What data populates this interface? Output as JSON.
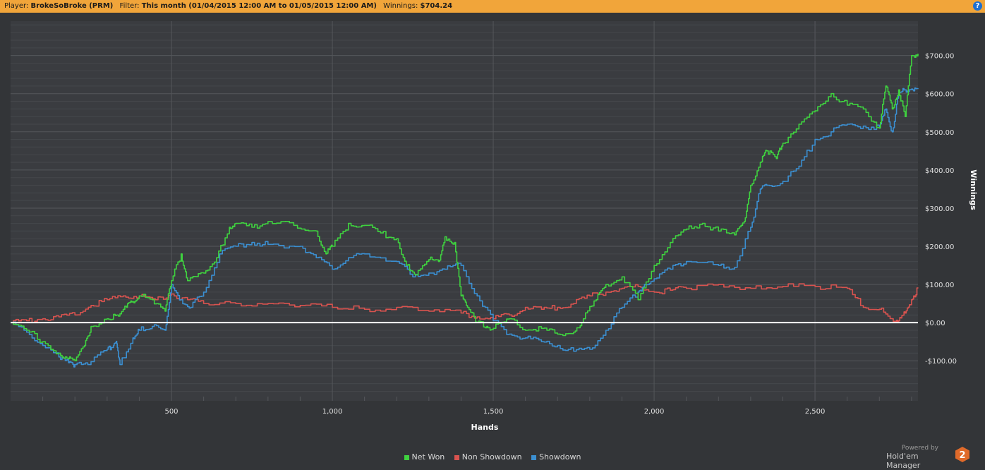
{
  "header": {
    "player_label": "Player:",
    "player_value": "BrokeSoBroke (PRM)",
    "filter_label": "Filter:",
    "filter_value": "This month (01/04/2015 12:00 AM to 01/05/2015 12:00 AM)",
    "winnings_label": "Winnings:",
    "winnings_value": "$704.24",
    "help_icon": "?"
  },
  "branding": {
    "line1": "Powered by",
    "line2": "Hold'em Manager",
    "logo_text": "2"
  },
  "colors": {
    "net_won": "#3fd13f",
    "non_showdown": "#d9534f",
    "showdown": "#3b8fd1",
    "zero_line": "#ffffff",
    "header_bg": "#f1a53a"
  },
  "chart_data": {
    "type": "line",
    "xlabel": "Hands",
    "ylabel": "Winnings",
    "xlim": [
      0,
      2820
    ],
    "ylim": [
      -205,
      790
    ],
    "x_ticks": [
      500,
      1000,
      1500,
      2000,
      2500
    ],
    "x_tick_labels": [
      "500",
      "1,000",
      "1,500",
      "2,000",
      "2,500"
    ],
    "y_ticks": [
      -100,
      0,
      100,
      200,
      300,
      400,
      500,
      600,
      700
    ],
    "y_tick_labels": [
      "-$100.00",
      "$0.00",
      "$100.00",
      "$200.00",
      "$300.00",
      "$400.00",
      "$500.00",
      "$600.00",
      "$700.00"
    ],
    "grid": true,
    "legend_position": "bottom-center",
    "series": [
      {
        "name": "Net Won",
        "color": "#3fd13f",
        "x": [
          0,
          50,
          100,
          150,
          180,
          200,
          230,
          250,
          300,
          330,
          360,
          380,
          400,
          440,
          480,
          500,
          530,
          550,
          600,
          640,
          680,
          700,
          750,
          800,
          880,
          950,
          980,
          1000,
          1050,
          1100,
          1150,
          1200,
          1230,
          1260,
          1300,
          1330,
          1350,
          1380,
          1400,
          1420,
          1450,
          1480,
          1500,
          1550,
          1600,
          1650,
          1700,
          1750,
          1780,
          1820,
          1850,
          1900,
          1950,
          2000,
          2050,
          2100,
          2150,
          2200,
          2250,
          2280,
          2300,
          2330,
          2350,
          2380,
          2400,
          2450,
          2500,
          2550,
          2600,
          2650,
          2700,
          2720,
          2740,
          2760,
          2780,
          2800,
          2820
        ],
        "y": [
          0,
          -20,
          -50,
          -80,
          -95,
          -100,
          -60,
          -10,
          10,
          20,
          40,
          55,
          70,
          60,
          30,
          110,
          180,
          110,
          130,
          170,
          250,
          260,
          250,
          265,
          255,
          240,
          180,
          200,
          260,
          255,
          235,
          220,
          150,
          125,
          165,
          160,
          225,
          210,
          70,
          40,
          0,
          -10,
          -15,
          10,
          -20,
          -15,
          -30,
          -25,
          10,
          60,
          100,
          120,
          60,
          150,
          210,
          245,
          260,
          240,
          230,
          265,
          360,
          420,
          450,
          430,
          470,
          520,
          555,
          600,
          570,
          560,
          510,
          620,
          560,
          610,
          540,
          700,
          705
        ]
      },
      {
        "name": "Non Showdown",
        "color": "#d9534f",
        "x": [
          0,
          50,
          100,
          150,
          200,
          250,
          300,
          350,
          400,
          450,
          500,
          550,
          600,
          700,
          800,
          900,
          1000,
          1100,
          1200,
          1300,
          1400,
          1450,
          1500,
          1550,
          1600,
          1650,
          1700,
          1750,
          1800,
          1850,
          1900,
          1950,
          2000,
          2050,
          2100,
          2200,
          2300,
          2400,
          2500,
          2600,
          2650,
          2700,
          2740,
          2760,
          2780,
          2800,
          2820
        ],
        "y": [
          0,
          5,
          10,
          15,
          20,
          45,
          60,
          70,
          70,
          60,
          75,
          60,
          50,
          50,
          50,
          45,
          40,
          35,
          40,
          30,
          25,
          15,
          10,
          20,
          40,
          35,
          40,
          50,
          70,
          80,
          90,
          95,
          80,
          85,
          90,
          100,
          90,
          95,
          95,
          90,
          40,
          35,
          10,
          5,
          25,
          60,
          90
        ]
      },
      {
        "name": "Showdown",
        "color": "#3b8fd1",
        "x": [
          0,
          50,
          100,
          150,
          180,
          200,
          240,
          300,
          320,
          330,
          340,
          380,
          400,
          440,
          480,
          500,
          530,
          560,
          600,
          650,
          700,
          750,
          800,
          900,
          950,
          1000,
          1050,
          1100,
          1200,
          1250,
          1300,
          1350,
          1400,
          1450,
          1500,
          1550,
          1600,
          1650,
          1700,
          1750,
          1800,
          1850,
          1900,
          1950,
          1970,
          2000,
          2050,
          2100,
          2200,
          2250,
          2300,
          2330,
          2350,
          2400,
          2450,
          2500,
          2550,
          2600,
          2650,
          2700,
          2720,
          2740,
          2760,
          2780,
          2800,
          2820
        ],
        "y": [
          0,
          -25,
          -60,
          -90,
          -105,
          -110,
          -110,
          -70,
          -60,
          -55,
          -110,
          -40,
          -20,
          -10,
          -20,
          100,
          60,
          40,
          80,
          180,
          200,
          210,
          205,
          200,
          170,
          140,
          170,
          180,
          160,
          120,
          130,
          140,
          150,
          70,
          5,
          -30,
          -40,
          -50,
          -60,
          -75,
          -70,
          -20,
          40,
          80,
          100,
          115,
          140,
          160,
          150,
          145,
          250,
          350,
          360,
          370,
          410,
          480,
          500,
          520,
          515,
          510,
          560,
          500,
          600,
          610,
          612,
          612
        ]
      }
    ]
  }
}
